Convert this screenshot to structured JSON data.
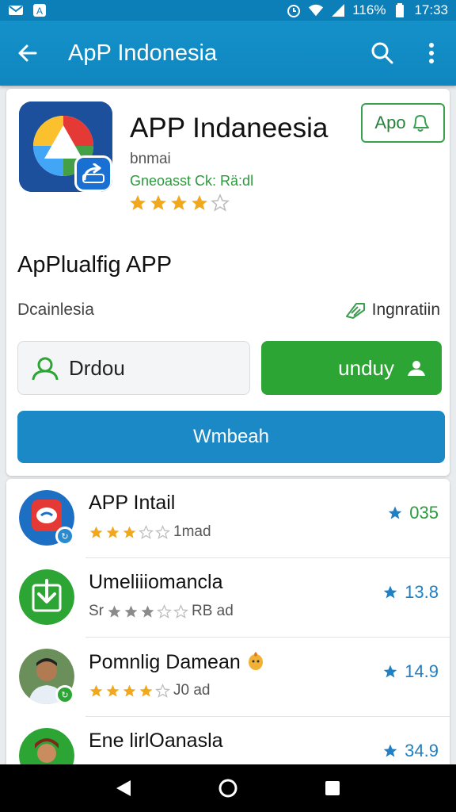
{
  "status": {
    "battery_text": "116%",
    "time": "17:33",
    "icons": [
      "email-icon",
      "alert-icon",
      "alarm-icon",
      "wifi-icon",
      "signal-icon",
      "battery-icon"
    ]
  },
  "appbar": {
    "title": "ApP Indonesia",
    "icons": [
      "back-arrow-icon",
      "search-icon",
      "more-vert-icon"
    ]
  },
  "detail": {
    "app_name": "APP Indaneesia",
    "publisher": "bnmai",
    "category": "Gneoasst Ck: Rä:dl",
    "stars": [
      1,
      1,
      1,
      1,
      0
    ],
    "rating_value": 4,
    "app_button_label": "Apo",
    "section_title": "ApPlualfig APP",
    "sub_left": "Dcainlesia",
    "sub_right": "Ingnratiin",
    "outline_button_label": "Drdou",
    "green_button_label": "unduy",
    "blue_button_label": "Wmbeah"
  },
  "list": [
    {
      "name": "APP Intail",
      "meta": "1mad",
      "stars": [
        1,
        1,
        1,
        0,
        0
      ],
      "rating": "035",
      "avatar": "chat-app-icon"
    },
    {
      "name": "Umeliiiomancla",
      "meta_prefix": "Sr",
      "meta": "RB ad",
      "stars": [
        1,
        1,
        1,
        0,
        0
      ],
      "rating": "13.8",
      "avatar": "download-icon"
    },
    {
      "name": "Pomnlig Damean",
      "meta": "J0 ad",
      "stars": [
        1,
        1,
        1,
        1,
        0
      ],
      "rating": "14.9",
      "avatar": "person-avatar"
    },
    {
      "name": "Ene lirlOanasla",
      "meta": "",
      "stars": [],
      "rating": "34.9",
      "avatar": "person-avatar"
    }
  ],
  "navbar": {
    "icons": [
      "back-triangle-icon",
      "home-circle-icon",
      "recents-square-icon"
    ]
  },
  "colors": {
    "primary": "#1591c9",
    "green": "#2ca534",
    "blue_button": "#1a89c5",
    "star_gold": "#f2a81d",
    "star_blue": "#1f80c6"
  }
}
